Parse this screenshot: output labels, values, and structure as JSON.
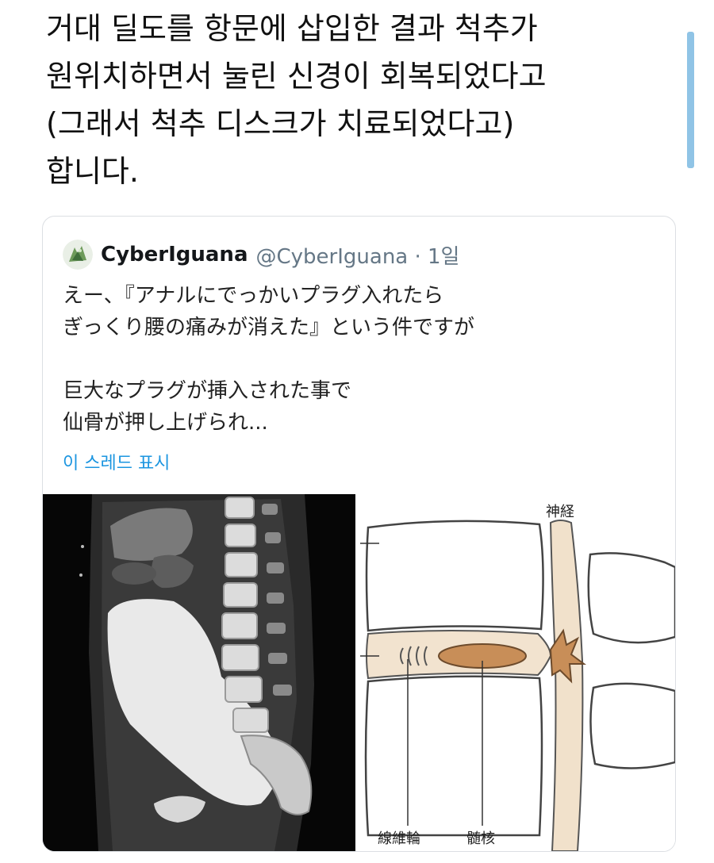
{
  "tweet": {
    "lines": [
      "거대 딜도를 항문에 삽입한 결과 척추가",
      "원위치하면서 눌린 신경이 회복되었다고",
      "(그래서 척추 디스크가 치료되었다고)",
      "합니다."
    ]
  },
  "quote": {
    "author_name": "CyberIguana",
    "author_meta": "@CyberIguana · 1일",
    "lines": [
      "えー、『アナルにでっかいプラグ入れたら",
      "ぎっくり腰の痛みが消えた』という件ですが",
      "",
      "巨大なプラグが挿入された事で",
      "仙骨が押し上げられ..."
    ],
    "thread_link": "이 스레드 표시"
  },
  "diagram": {
    "label_nerve": "神経",
    "label_annulus": "線維輪",
    "label_nucleus": "髄核"
  },
  "icons": {
    "avatar": "iguana-avatar"
  },
  "colors": {
    "link": "#1b95e0",
    "scroll": "#90c4e6",
    "nucleus": "#c88e58",
    "disc": "#f2e3cf"
  }
}
